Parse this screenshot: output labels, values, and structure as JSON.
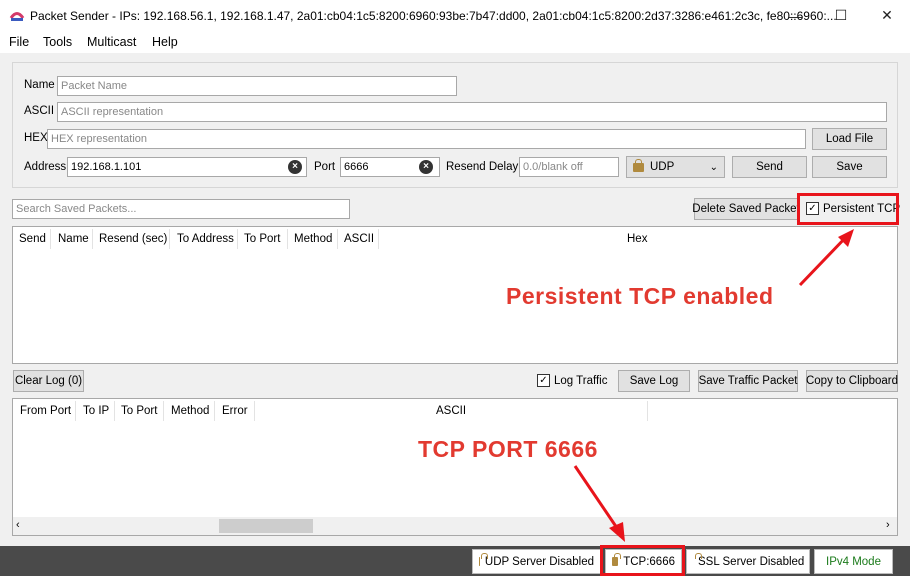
{
  "window": {
    "title": "Packet Sender - IPs: 192.168.56.1, 192.168.1.47, 2a01:cb04:1c5:8200:6960:93be:7b47:dd00, 2a01:cb04:1c5:8200:2d37:3286:e461:2c3c, fe80::6960:...",
    "minimize": "—",
    "maximize": "☐",
    "close": "✕"
  },
  "menu": [
    "File",
    "Tools",
    "Multicast",
    "Help"
  ],
  "form": {
    "name_label": "Name",
    "name_placeholder": "Packet Name",
    "ascii_label": "ASCII",
    "ascii_placeholder": "ASCII representation",
    "hex_label": "HEX",
    "hex_placeholder": "HEX representation",
    "load_file": "Load File",
    "address_label": "Address",
    "address_value": "192.168.1.101",
    "port_label": "Port",
    "port_value": "6666",
    "resend_label": "Resend Delay",
    "resend_placeholder": "0.0/blank off",
    "protocol": "UDP",
    "send": "Send",
    "save": "Save"
  },
  "saved": {
    "search_placeholder": "Search Saved Packets...",
    "delete": "Delete Saved Packet",
    "persistent_tcp": "Persistent TCP",
    "columns": [
      "Send",
      "Name",
      "Resend (sec)",
      "To Address",
      "To Port",
      "Method",
      "ASCII",
      "Hex"
    ]
  },
  "log": {
    "clear": "Clear Log (0)",
    "log_traffic": "Log Traffic",
    "save_log": "Save Log",
    "save_traffic": "Save Traffic Packet",
    "copy_clipboard": "Copy to Clipboard",
    "columns": [
      "From Port",
      "To IP",
      "To Port",
      "Method",
      "Error",
      "ASCII"
    ]
  },
  "status": {
    "udp": "UDP Server Disabled",
    "tcp": "TCP:6666",
    "ssl": "SSL Server Disabled",
    "ipv4": "IPv4 Mode"
  },
  "annotations": {
    "persistent": "Persistent TCP enabled",
    "port": "TCP PORT 6666",
    "color": "#e8141b"
  }
}
